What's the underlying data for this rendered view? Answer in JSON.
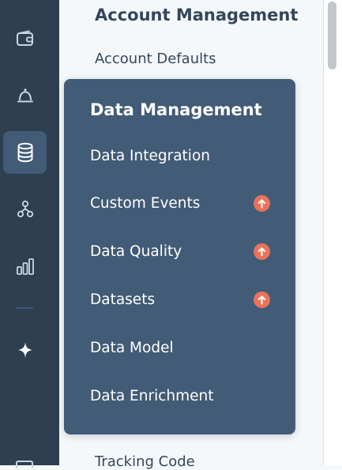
{
  "nav_rail": {
    "items": [
      {
        "icon": "wallet-icon",
        "active": false
      },
      {
        "icon": "bell-icon",
        "active": false
      },
      {
        "icon": "database-icon",
        "active": true
      },
      {
        "icon": "org-tree-icon",
        "active": false
      },
      {
        "icon": "bar-chart-icon",
        "active": false
      },
      {
        "icon": "sparkle-icon",
        "active": false
      }
    ]
  },
  "settings_menu": {
    "section_title": "Account Management",
    "items": [
      "Account Defaults",
      "Tracking Code"
    ]
  },
  "flyout": {
    "title": "Data Management",
    "items": [
      {
        "label": "Data Integration",
        "upgrade": false
      },
      {
        "label": "Custom Events",
        "upgrade": true
      },
      {
        "label": "Data Quality",
        "upgrade": true
      },
      {
        "label": "Datasets",
        "upgrade": true
      },
      {
        "label": "Data Model",
        "upgrade": false
      },
      {
        "label": "Data Enrichment",
        "upgrade": false
      }
    ]
  },
  "colors": {
    "rail_bg": "#2e3f50",
    "rail_active": "#425b76",
    "flyout_bg": "#425b76",
    "heading_text": "#33475b",
    "upgrade_badge": "#e8735a"
  }
}
